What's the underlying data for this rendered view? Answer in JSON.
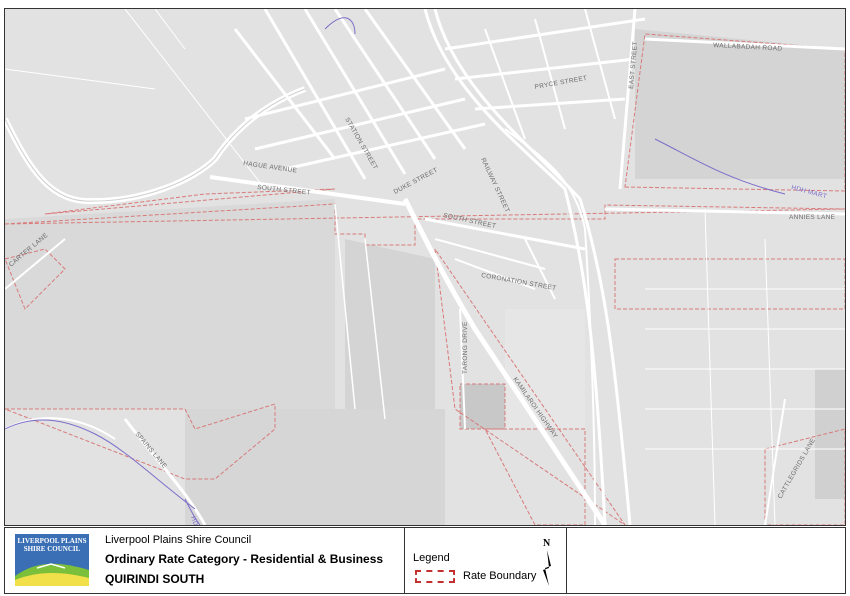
{
  "map": {
    "road_labels": {
      "wallabadah_road": "WALLABADAH ROAD",
      "annies_lane": "ANNIES LANE",
      "south_street": "SOUTH STREET",
      "south_street_2": "SOUTH STREET",
      "hague_avenue": "HAGUE AVENUE",
      "taroona_drive": "TARONG DRIVE",
      "kamilaroi_highway": "KAMILAROI HIGHWAY",
      "spains_lane": "SPAINS LANE",
      "carter_lane": "CARTER LANE",
      "east_street": "EAST STREET",
      "duke_street": "DUKE STREET",
      "railway_street": "RAILWAY STREET",
      "coronation_street": "CORONATION STREET",
      "cattlegrids_lane": "CATTLEGRIDS LANE",
      "hdh_mart": "HDH MART",
      "pryce_street": "PRYCE STREET",
      "station_street": "STATION STREET",
      "hdr": "HDR"
    },
    "colors": {
      "background": "#e2e2e2",
      "road": "#ffffff",
      "rate_boundary": "#d87a7a",
      "creek": "#7b6fc9"
    }
  },
  "footer": {
    "council_name": "Liverpool Plains Shire Council",
    "rate_category": "Ordinary Rate Category - Residential & Business",
    "map_subtitle": "QUIRINDI SOUTH",
    "logo_text": "LIVERPOOL PLAINS SHIRE COUNCIL",
    "legend_title": "Legend",
    "legend_item": "Rate Boundary",
    "north_label": "N"
  }
}
